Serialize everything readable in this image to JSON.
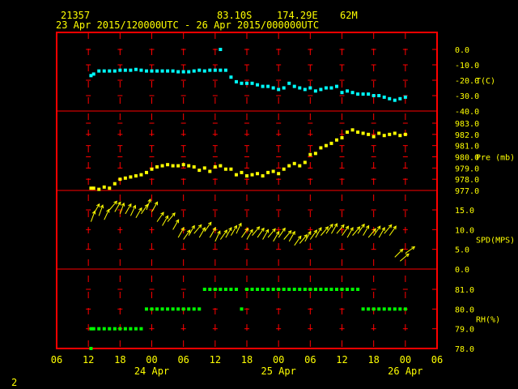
{
  "header": {
    "station": "21357",
    "lat": "83.10S",
    "lon": "174.29E",
    "elev": "62M",
    "period": "23 Apr 2015/120000UTC - 26 Apr 2015/000000UTC"
  },
  "footer": {
    "page": "2"
  },
  "colors": {
    "frame": "#ff0000",
    "text": "#ffff00",
    "temp": "#00ffff",
    "pres": "#ffff00",
    "wind": "#ffff00",
    "rh": "#00ff00",
    "grid": "#ff0000"
  },
  "chart_data": {
    "type": "scatter",
    "time_axis": {
      "start_offset_h": -6,
      "end_offset_h": 66,
      "tick_labels": [
        "06",
        "12",
        "18",
        "00",
        "06",
        "12",
        "18",
        "00",
        "06",
        "12",
        "18",
        "00",
        "06"
      ],
      "day_labels": [
        {
          "hour": 12,
          "label": "24 Apr"
        },
        {
          "hour": 36,
          "label": "25 Apr"
        },
        {
          "hour": 60,
          "label": "26 Apr"
        }
      ]
    },
    "panels": [
      {
        "name": "temperature",
        "label": "T(C)",
        "ylim": [
          -40,
          0
        ],
        "ticks": [
          "0.0",
          "-10.0",
          "-20.0",
          "-30.0",
          "-40.0"
        ],
        "tick_values": [
          0,
          -10,
          -20,
          -30,
          -40
        ],
        "series": [
          {
            "x": [
              0.5,
              1,
              2,
              3,
              4,
              5,
              6,
              7,
              8,
              9,
              10,
              11,
              12,
              13,
              14,
              15,
              16,
              17,
              18,
              19,
              20,
              21,
              22,
              23,
              24,
              25,
              26,
              27,
              28,
              29,
              30,
              31,
              32,
              33,
              34,
              35,
              36,
              37,
              38,
              39,
              40,
              41,
              42,
              43,
              44,
              45,
              46,
              47,
              48,
              49,
              50,
              51,
              52,
              53,
              54,
              55,
              56,
              57,
              58,
              59,
              60
            ],
            "y": [
              -17,
              -16,
              -14,
              -14,
              -14,
              -14,
              -13.5,
              -13.5,
              -13.5,
              -13,
              -13.5,
              -14,
              -14,
              -14,
              -14,
              -14,
              -14,
              -14.5,
              -14.5,
              -14.5,
              -14,
              -13.5,
              -14,
              -13.5,
              -13.5,
              -13.5,
              -13.5,
              -18,
              -21,
              -22,
              -22,
              -22,
              -23,
              -24,
              -24,
              -25,
              -26,
              -25,
              -22,
              -24,
              -25,
              -26,
              -25,
              -27,
              -26,
              -25,
              -25,
              -24,
              -28,
              -27,
              -28,
              -29,
              -29,
              -29,
              -30,
              -30,
              -31,
              -32,
              -33,
              -32,
              -31
            ],
            "outlier": {
              "x": 25,
              "y": 0
            }
          }
        ]
      },
      {
        "name": "pressure",
        "label": "Pre (mb)",
        "ylim": [
          977,
          983
        ],
        "ticks": [
          "983.0",
          "982.0",
          "981.0",
          "980.0",
          "979.0",
          "978.0",
          "977.0"
        ],
        "tick_values": [
          983,
          982,
          981,
          980,
          979,
          978,
          977
        ],
        "series": [
          {
            "x": [
              0.5,
              1,
              2,
              3,
              4,
              5,
              6,
              7,
              8,
              9,
              10,
              11,
              12,
              13,
              14,
              15,
              16,
              17,
              18,
              19,
              20,
              21,
              22,
              23,
              24,
              25,
              26,
              27,
              28,
              29,
              30,
              31,
              32,
              33,
              34,
              35,
              36,
              37,
              38,
              39,
              40,
              41,
              42,
              43,
              44,
              45,
              46,
              47,
              48,
              49,
              50,
              51,
              52,
              53,
              54,
              55,
              56,
              57,
              58,
              59,
              60
            ],
            "y": [
              977.2,
              977.2,
              977.1,
              977.3,
              977.2,
              977.6,
              978.0,
              978.1,
              978.2,
              978.3,
              978.4,
              978.6,
              978.9,
              979.1,
              979.2,
              979.3,
              979.2,
              979.2,
              979.3,
              979.2,
              979.1,
              978.8,
              979.0,
              978.7,
              979.1,
              979.2,
              978.9,
              978.9,
              978.4,
              978.6,
              978.3,
              978.4,
              978.5,
              978.3,
              978.6,
              978.7,
              978.5,
              978.9,
              979.2,
              979.4,
              979.2,
              979.5,
              980.2,
              980.3,
              980.8,
              981.0,
              981.2,
              981.5,
              981.7,
              982.2,
              982.4,
              982.2,
              982.1,
              982.0,
              981.8,
              982.1,
              981.9,
              982.0,
              982.1,
              981.9,
              982.0
            ]
          }
        ]
      },
      {
        "name": "wind_speed",
        "label": "SPD(MPS)",
        "ylim": [
          0,
          15
        ],
        "ticks": [
          "15.0",
          "10.0",
          "5.0",
          "0.0"
        ],
        "tick_values": [
          15,
          10,
          5,
          0
        ],
        "series": [
          {
            "x": [
              0.5,
              1,
              2,
              3,
              4,
              5,
              6,
              7,
              8,
              9,
              10,
              11,
              12,
              13,
              14,
              15,
              16,
              17,
              18,
              19,
              20,
              21,
              22,
              23,
              24,
              25,
              26,
              27,
              28,
              29,
              30,
              31,
              32,
              33,
              34,
              35,
              36,
              37,
              38,
              39,
              40,
              41,
              42,
              43,
              44,
              45,
              46,
              47,
              48,
              49,
              50,
              51,
              52,
              53,
              54,
              55,
              56,
              57,
              58,
              59,
              60
            ],
            "y": [
              12,
              14,
              13.5,
              12.5,
              15,
              14.5,
              14,
              14,
              13.5,
              13,
              14,
              15,
              14.5,
              12,
              11,
              12,
              10,
              8,
              7.5,
              8.5,
              9,
              8,
              9.5,
              8,
              7,
              7.5,
              8,
              8.5,
              9,
              8,
              7.5,
              8.5,
              8,
              7.5,
              8,
              7,
              8,
              7.5,
              7,
              6,
              6.5,
              7,
              7.5,
              8,
              8.5,
              9,
              9,
              9,
              8.5,
              8,
              8.5,
              9,
              8.5,
              8,
              8.5,
              8,
              9,
              8.5,
              3,
              2,
              4
            ],
            "dir": [
              200,
              210,
              200,
              205,
              220,
              210,
              200,
              210,
              205,
              210,
              215,
              200,
              210,
              215,
              210,
              220,
              210,
              210,
              215,
              210,
              220,
              210,
              215,
              210,
              205,
              215,
              210,
              210,
              205,
              215,
              210,
              220,
              215,
              210,
              220,
              210,
              215,
              220,
              210,
              215,
              220,
              210,
              215,
              210,
              220,
              215,
              210,
              220,
              215,
              210,
              220,
              215,
              210,
              220,
              215,
              210,
              220,
              215,
              225,
              230,
              235
            ]
          }
        ]
      },
      {
        "name": "humidity",
        "label": "RH(%)",
        "ylim": [
          78,
          81
        ],
        "ticks": [
          "81.0",
          "80.0",
          "79.0",
          "78.0"
        ],
        "tick_values": [
          81,
          80,
          79,
          78
        ],
        "series": [
          {
            "x": [
              0.5,
              1,
              2,
              3,
              4,
              5,
              6,
              7,
              8,
              9,
              10,
              11,
              12,
              13,
              14,
              15,
              16,
              17,
              18,
              19,
              20,
              21,
              22,
              23,
              24,
              25,
              26,
              27,
              28,
              29,
              30,
              31,
              32,
              33,
              34,
              35,
              36,
              37,
              38,
              39,
              40,
              41,
              42,
              43,
              44,
              45,
              46,
              47,
              48,
              49,
              50,
              51,
              52,
              53,
              54,
              55,
              56,
              57,
              58,
              59,
              60
            ],
            "y": [
              79,
              79,
              79,
              79,
              79,
              79,
              79,
              79,
              79,
              79,
              79,
              80,
              80,
              80,
              80,
              80,
              80,
              80,
              80,
              80,
              80,
              80,
              81,
              81,
              81,
              81,
              81,
              81,
              81,
              80,
              81,
              81,
              81,
              81,
              81,
              81,
              81,
              81,
              81,
              81,
              81,
              81,
              81,
              81,
              81,
              81,
              81,
              81,
              81,
              81,
              81,
              81,
              80,
              80,
              80,
              80,
              80,
              80,
              80,
              80,
              80
            ],
            "outlier": {
              "x": 0.5,
              "y": 78
            }
          }
        ]
      }
    ]
  }
}
